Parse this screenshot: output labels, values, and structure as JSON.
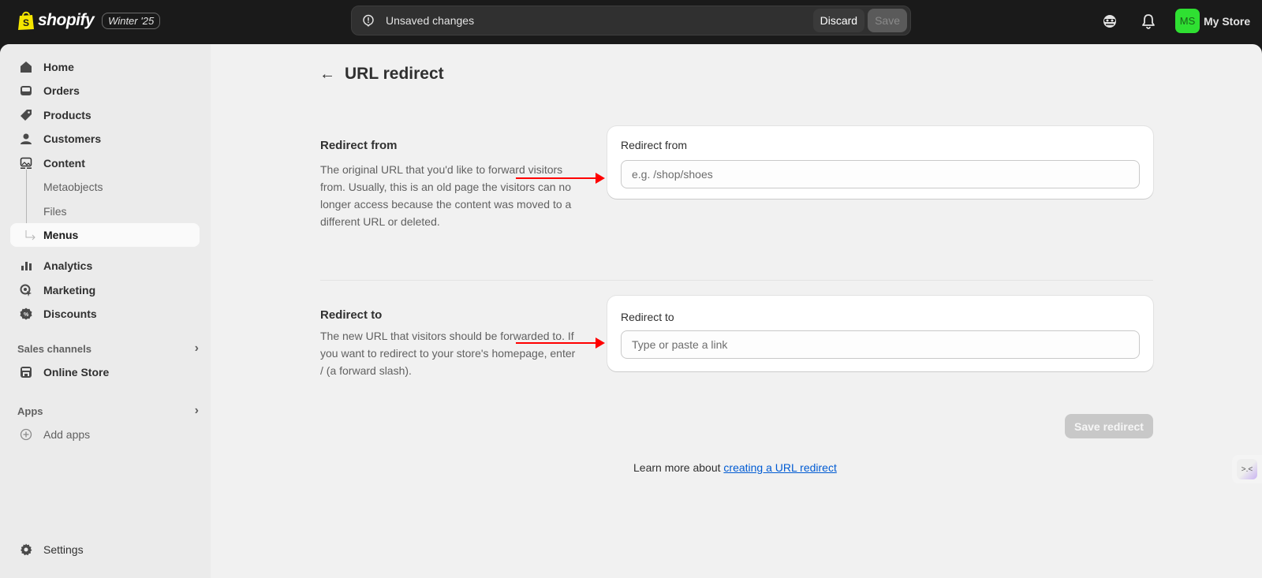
{
  "topbar": {
    "brand": "shopify",
    "edition": "Winter '25",
    "savebar": {
      "message": "Unsaved changes",
      "discard_label": "Discard",
      "save_label": "Save"
    },
    "icons": [
      "incognito-icon",
      "bell-icon"
    ],
    "store": {
      "initials": "MS",
      "name": "My Store",
      "avatar_color": "#2fe032"
    }
  },
  "sidebar": {
    "items": [
      {
        "label": "Home",
        "icon": "home-icon"
      },
      {
        "label": "Orders",
        "icon": "inbox-icon"
      },
      {
        "label": "Products",
        "icon": "tag-icon"
      },
      {
        "label": "Customers",
        "icon": "person-icon"
      },
      {
        "label": "Content",
        "icon": "image-icon"
      },
      {
        "label": "Metaobjects"
      },
      {
        "label": "Files"
      },
      {
        "label": "Menus",
        "active": true
      },
      {
        "label": "Analytics",
        "icon": "bar-chart-icon"
      },
      {
        "label": "Marketing",
        "icon": "target-icon"
      },
      {
        "label": "Discounts",
        "icon": "discount-icon"
      }
    ],
    "sales_channels": {
      "heading": "Sales channels",
      "items": [
        {
          "label": "Online Store",
          "icon": "store-icon"
        }
      ]
    },
    "apps": {
      "heading": "Apps",
      "items": [
        {
          "label": "Add apps",
          "icon": "plus-circle-icon"
        }
      ]
    },
    "settings": {
      "label": "Settings",
      "icon": "gear-icon"
    }
  },
  "main": {
    "title": "URL redirect",
    "sections": [
      {
        "title": "Redirect from",
        "description": "The original URL that you'd like to forward visitors from. Usually, this is an old page the visitors can no longer access because the content was moved to a different URL or deleted.",
        "field_label": "Redirect from",
        "placeholder": "e.g. /shop/shoes",
        "value": ""
      },
      {
        "title": "Redirect to",
        "description": "The new URL that visitors should be forwarded to. If you want to redirect to your store's homepage, enter / (a forward slash).",
        "field_label": "Redirect to",
        "placeholder": "Type or paste a link",
        "value": ""
      }
    ],
    "save_button": "Save redirect",
    "learn_more": {
      "prefix": "Learn more about ",
      "link_text": "creating a URL redirect"
    },
    "sidekick_glyph": ">.<"
  },
  "annotations": {
    "arrow_color": "#ff0000"
  }
}
